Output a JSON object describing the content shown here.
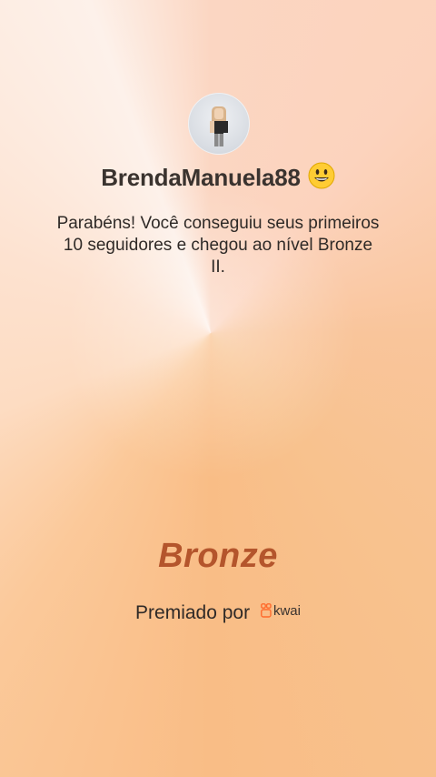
{
  "profile": {
    "avatar_icon": "user-avatar",
    "username": "BrendaManuela88",
    "emoji": "grinning-face-icon"
  },
  "message": {
    "text": "Parabéns! Você conseguiu seus primeiros 10 seguidores e chegou ao nível Bronze II."
  },
  "level": {
    "name": "Bronze",
    "color": "#b4552c"
  },
  "award": {
    "label": "Premiado por",
    "brand_name": "kwai",
    "brand_icon": "kwai-logo-icon",
    "brand_color": "#ff6a2b"
  }
}
